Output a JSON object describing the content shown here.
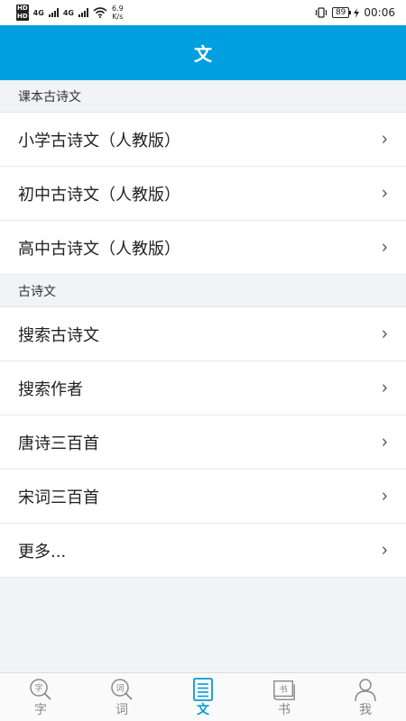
{
  "status_bar": {
    "hd1": "HD",
    "hd2": "HD",
    "net1": "4G",
    "net2": "4G",
    "speed_value": "6.9",
    "speed_unit": "K/s",
    "battery": "89",
    "time": "00:06"
  },
  "header": {
    "title": "文"
  },
  "sections": [
    {
      "title": "课本古诗文",
      "items": [
        {
          "label": "小学古诗文（人教版）"
        },
        {
          "label": "初中古诗文（人教版）"
        },
        {
          "label": "高中古诗文（人教版）"
        }
      ]
    },
    {
      "title": "古诗文",
      "items": [
        {
          "label": "搜索古诗文"
        },
        {
          "label": "搜索作者"
        },
        {
          "label": "唐诗三百首"
        },
        {
          "label": "宋词三百首"
        },
        {
          "label": "更多..."
        }
      ]
    }
  ],
  "chevron": "›",
  "tabs": [
    {
      "label": "字",
      "icon": "magnifier-char-icon",
      "icon_text": "字",
      "active": false
    },
    {
      "label": "词",
      "icon": "magnifier-word-icon",
      "icon_text": "词",
      "active": false
    },
    {
      "label": "文",
      "icon": "document-icon",
      "active": true
    },
    {
      "label": "书",
      "icon": "book-icon",
      "icon_text": "书",
      "active": false
    },
    {
      "label": "我",
      "icon": "person-icon",
      "active": false
    }
  ],
  "colors": {
    "primary": "#00a0e0",
    "tab_active": "#0a9bd6",
    "tab_inactive": "#888888",
    "background": "#f2f3f5"
  }
}
